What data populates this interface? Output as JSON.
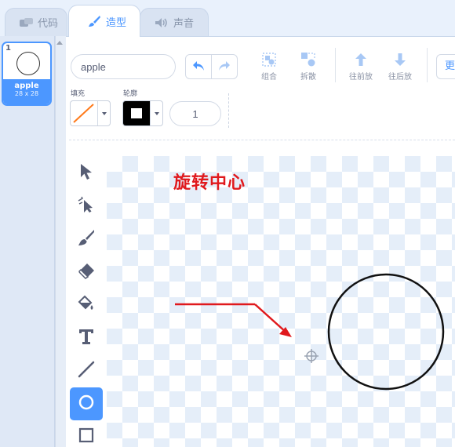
{
  "tabs": [
    {
      "label": "代码",
      "icon": "code-icon"
    },
    {
      "label": "造型",
      "icon": "brush-icon"
    },
    {
      "label": "声音",
      "icon": "speaker-icon"
    }
  ],
  "costume": {
    "index": "1",
    "name": "apple",
    "size": "28 x 28"
  },
  "toolbar": {
    "costume_name": "apple",
    "group_label": "组合",
    "ungroup_label": "拆散",
    "forward_label": "往前放",
    "backward_label": "往后放",
    "more_label": "更"
  },
  "props": {
    "fill_label": "填充",
    "outline_label": "轮廓",
    "outline_width": "1",
    "fill_color": "#ff7a1a",
    "outline_color": "#000000"
  },
  "tools": [
    "select-icon",
    "reshape-icon",
    "brush-icon",
    "eraser-icon",
    "fill-icon",
    "text-icon",
    "line-icon",
    "circle-icon",
    "rectangle-icon"
  ],
  "annotation": {
    "label": "旋转中心",
    "color": "#e0191d"
  },
  "colors": {
    "accent": "#4c97ff",
    "panel_bg": "#e9f1fc"
  }
}
